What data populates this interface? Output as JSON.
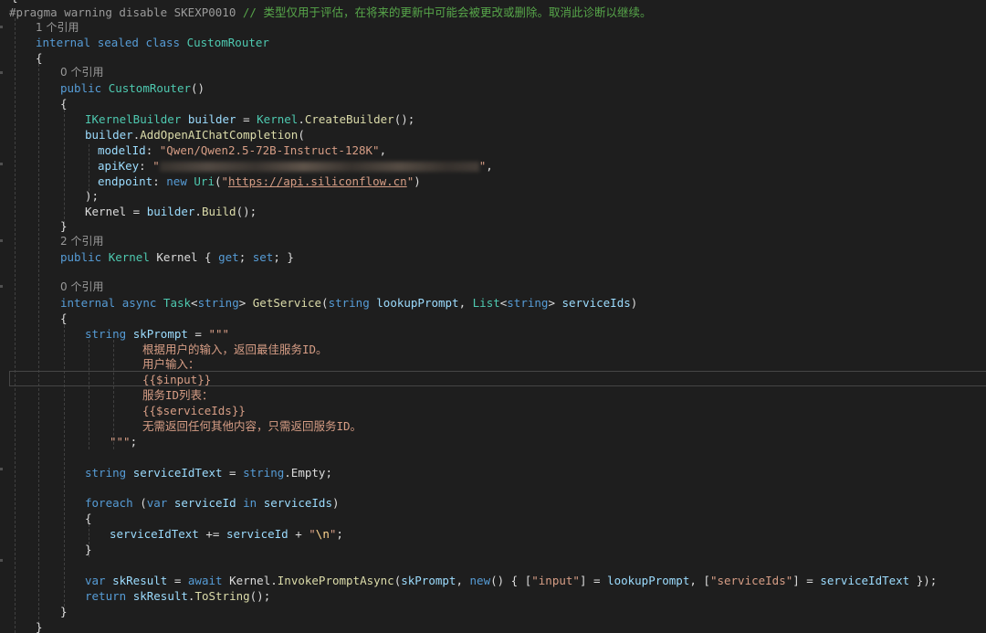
{
  "editor": {
    "pragma": {
      "directive": "#pragma",
      "rest": " warning disable SKEXP0010",
      "comment": " // 类型仅用于评估，在将来的更新中可能会被更改或删除。取消此诊断以继续。"
    },
    "refs": {
      "class": "1 个引用",
      "ctor": "0 个引用",
      "prop": "2 个引用",
      "method": "0 个引用"
    },
    "class_decl": {
      "kw1": "internal",
      "kw2": "sealed",
      "kw3": "class",
      "name": "CustomRouter"
    },
    "ctor_decl": {
      "kw": "public",
      "name": "CustomRouter",
      "parens": "()"
    },
    "builder_line": {
      "type": "IKernelBuilder",
      "var": "builder",
      "eq": " = ",
      "cls": "Kernel",
      "dot": ".",
      "method": "CreateBuilder",
      "end": "();"
    },
    "add_line": {
      "var": "builder",
      "dot": ".",
      "method": "AddOpenAIChatCompletion",
      "paren": "("
    },
    "model_line": {
      "name": "modelId",
      "colon": ": ",
      "value": "\"Qwen/Qwen2.5-72B-Instruct-128K\"",
      "comma": ","
    },
    "apikey_line": {
      "name": "apiKey",
      "colon": ": ",
      "open_quote": "\"",
      "close_quote": "\"",
      "comma": ","
    },
    "endpoint_line": {
      "name": "endpoint",
      "colon": ": ",
      "kw_new": "new",
      "type": "Uri",
      "open": "(",
      "q1": "\"",
      "url": "https://api.siliconflow.cn",
      "q2": "\"",
      "close": ")"
    },
    "close_call": ");",
    "kernel_assign": {
      "target": "Kernel",
      "eq": " = ",
      "var": "builder",
      "dot": ".",
      "method": "Build",
      "end": "();"
    },
    "prop_decl": {
      "kw": "public",
      "type": "Kernel",
      "name": "Kernel",
      "open": " { ",
      "get": "get",
      "semi1": "; ",
      "set": "set",
      "close": "; }"
    },
    "method_decl": {
      "kw1": "internal",
      "kw2": "async",
      "type": "Task",
      "lt": "<",
      "tkw": "string",
      "gt": ">",
      "name": "GetService",
      "open": "(",
      "p1type": "string",
      "p1": "lookupPrompt",
      "comma": ", ",
      "p2type": "List",
      "p2lt": "<",
      "p2tkw": "string",
      "p2gt": ">",
      "p2": "serviceIds",
      "close": ")"
    },
    "skprompt_decl": {
      "type": "string",
      "name": "skPrompt",
      "eq": " = ",
      "open": "\"\"\""
    },
    "prompt_lines": {
      "l1": "根据用户的输入，返回最佳服务ID。",
      "l2": "用户输入：",
      "l3": "{{$input}}",
      "l4": "服务ID列表：",
      "l5": "{{$serviceIds}}",
      "l6": "无需返回任何其他内容，只需返回服务ID。"
    },
    "prompt_close": {
      "quotes": "\"\"\"",
      "semi": ";"
    },
    "sid_decl": {
      "type": "string",
      "name": "serviceIdText",
      "eq": " = ",
      "kw": "string",
      "dot": ".",
      "member": "Empty",
      "semi": ";"
    },
    "foreach_line": {
      "kw": "foreach",
      "open": " (",
      "var": "var",
      "name": "serviceId",
      "in": "in",
      "coll": "serviceIds",
      "close": ")"
    },
    "append_line": {
      "target": "serviceIdText",
      "op": " += ",
      "src": "serviceId",
      "plus": " + ",
      "q1": "\"",
      "esc": "\\n",
      "q2": "\"",
      "semi": ";"
    },
    "result_line": {
      "var": "var",
      "name": "skResult",
      "eq": " = ",
      "await": "await",
      "cls": "Kernel",
      "dot": ".",
      "method": "InvokePromptAsync",
      "open": "(",
      "arg1": "skPrompt",
      "comma": ", ",
      "new": "new",
      "mid": "() { [",
      "k1": "\"input\"",
      "as1": "] = ",
      "v1": "lookupPrompt",
      "sep": ", [",
      "k2": "\"serviceIds\"",
      "as2": "] = ",
      "v2": "serviceIdText",
      "end": " });"
    },
    "return_line": {
      "kw": "return",
      "name": "skResult",
      "dot": ".",
      "method": "ToString",
      "end": "();"
    },
    "brace_open": "{",
    "brace_close": "}",
    "colors": {
      "background": "#1e1e1e",
      "keyword": "#569cd6",
      "type": "#4ec9b0",
      "method": "#dcdcaa",
      "identifier": "#9cdcfe",
      "string": "#d69d85",
      "comment": "#57a64a"
    }
  }
}
